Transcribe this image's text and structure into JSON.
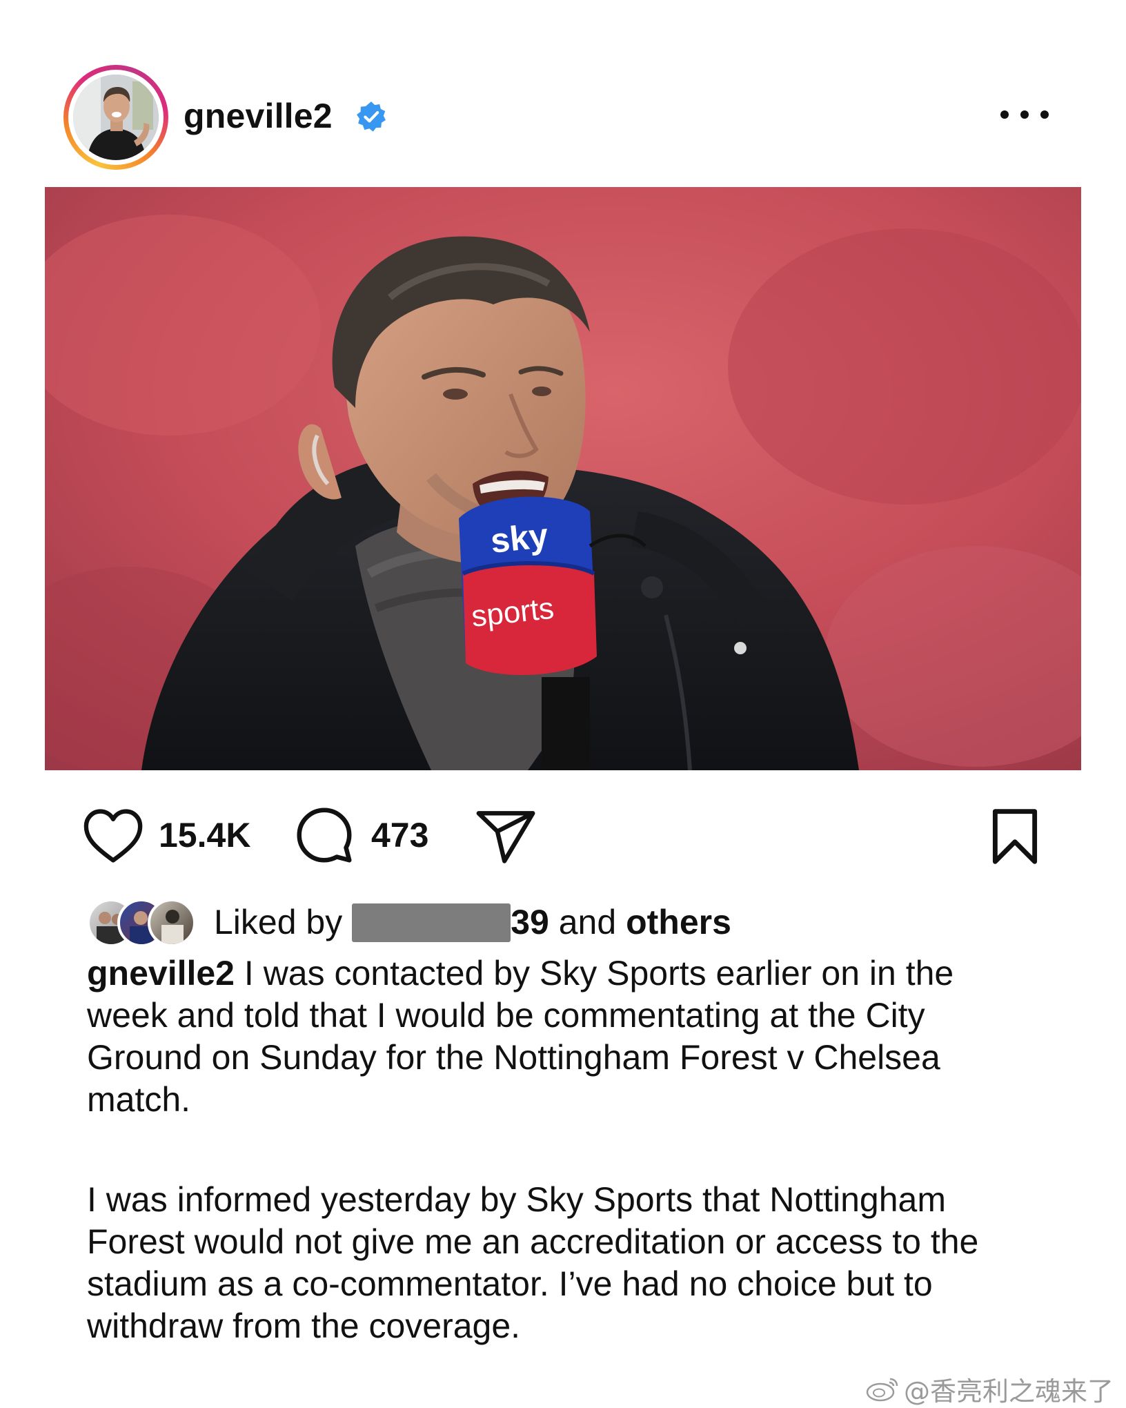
{
  "post": {
    "username": "gneville2",
    "verified": true,
    "more_icon": "more-horizontal-icon"
  },
  "photo": {
    "microphone_brand_top": "sky",
    "microphone_brand_bottom": "sports"
  },
  "actions": {
    "likes": "15.4K",
    "comments": "473",
    "icons": [
      "heart-icon",
      "comment-icon",
      "share-icon",
      "bookmark-icon"
    ]
  },
  "liked_by": {
    "prefix": "Liked by",
    "visible_suffix": "39",
    "middle": " and ",
    "others": "others"
  },
  "caption": {
    "username": "gneville2",
    "paragraph1": "I was contacted by Sky Sports earlier on in the week and told that I would be commentating at the City Ground on Sunday for the Nottingham Forest v Chelsea match.",
    "paragraph2": "I was informed yesterday by Sky Sports that Nottingham Forest would not give me an accreditation or access to the stadium as a co-commentator. I’ve had no choice but to withdraw from the coverage."
  },
  "watermark": {
    "text": "@香亮利之魂来了"
  },
  "colors": {
    "verified_blue": "#3897f0",
    "text": "#111111",
    "photo_background": "#c84e5a",
    "mic_blue": "#1f3fb8",
    "mic_red": "#d8263a"
  }
}
